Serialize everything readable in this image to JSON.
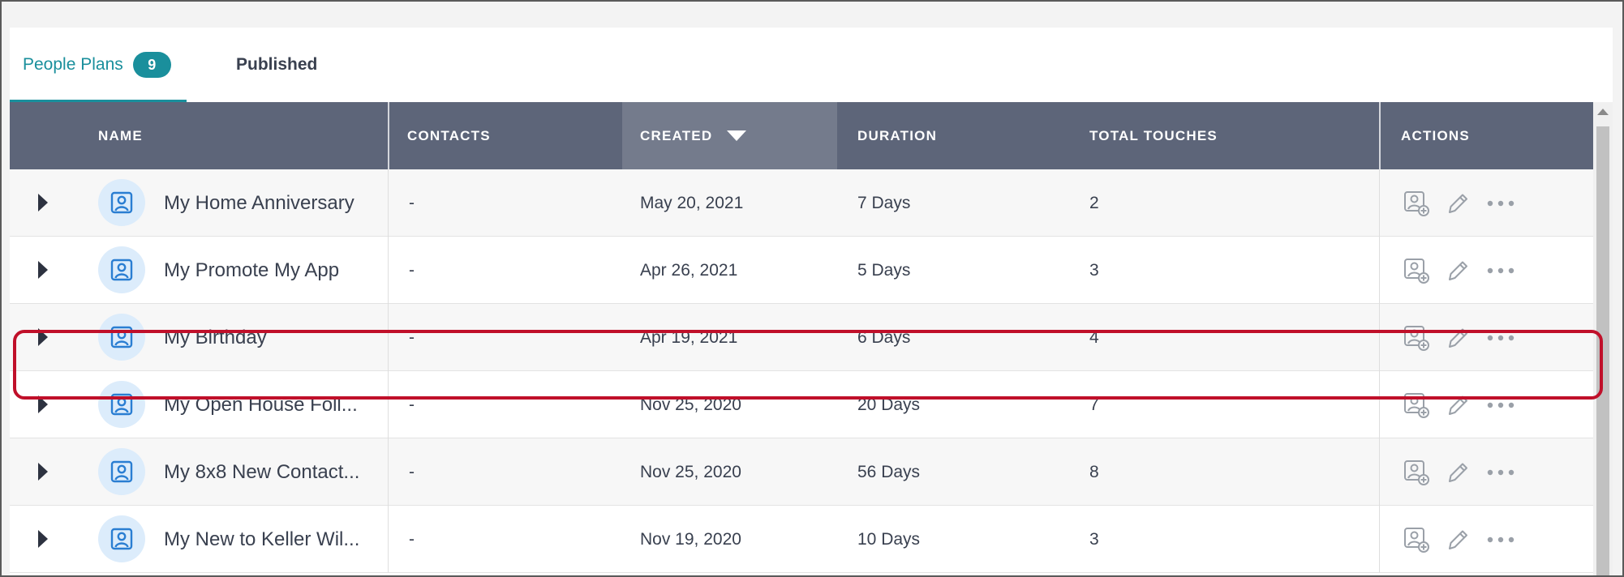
{
  "tabs": {
    "people_plans": {
      "label": "People Plans",
      "count": "9"
    },
    "published": {
      "label": "Published"
    }
  },
  "table": {
    "headers": {
      "name": "NAME",
      "contacts": "CONTACTS",
      "created": "CREATED",
      "duration": "DURATION",
      "total_touches": "TOTAL TOUCHES",
      "actions": "ACTIONS"
    },
    "sort": {
      "column": "created",
      "direction": "descending"
    },
    "rows": [
      {
        "name": "My Home Anniversary",
        "contacts": "-",
        "created": "May 20, 2021",
        "duration": "7 Days",
        "touches": "2"
      },
      {
        "name": "My Promote My App",
        "contacts": "-",
        "created": "Apr 26, 2021",
        "duration": "5 Days",
        "touches": "3"
      },
      {
        "name": "My Birthday",
        "contacts": "-",
        "created": "Apr 19, 2021",
        "duration": "6 Days",
        "touches": "4"
      },
      {
        "name": "My Open House Foll...",
        "contacts": "-",
        "created": "Nov 25, 2020",
        "duration": "20 Days",
        "touches": "7"
      },
      {
        "name": "My 8x8 New Contact...",
        "contacts": "-",
        "created": "Nov 25, 2020",
        "duration": "56 Days",
        "touches": "8"
      },
      {
        "name": "My New to Keller Wil...",
        "contacts": "-",
        "created": "Nov 19, 2020",
        "duration": "10 Days",
        "touches": "3"
      }
    ],
    "row_icons": {
      "expander": "caret-right-icon",
      "avatar": "person-plan-icon",
      "actions": [
        "add-contact-icon",
        "pencil-icon",
        "more-options-icon"
      ]
    }
  },
  "colors": {
    "accent": "#1a8f9c",
    "header_bg": "#5d6579",
    "header_sorted_bg": "#747b8c",
    "highlight": "#c0102a"
  }
}
